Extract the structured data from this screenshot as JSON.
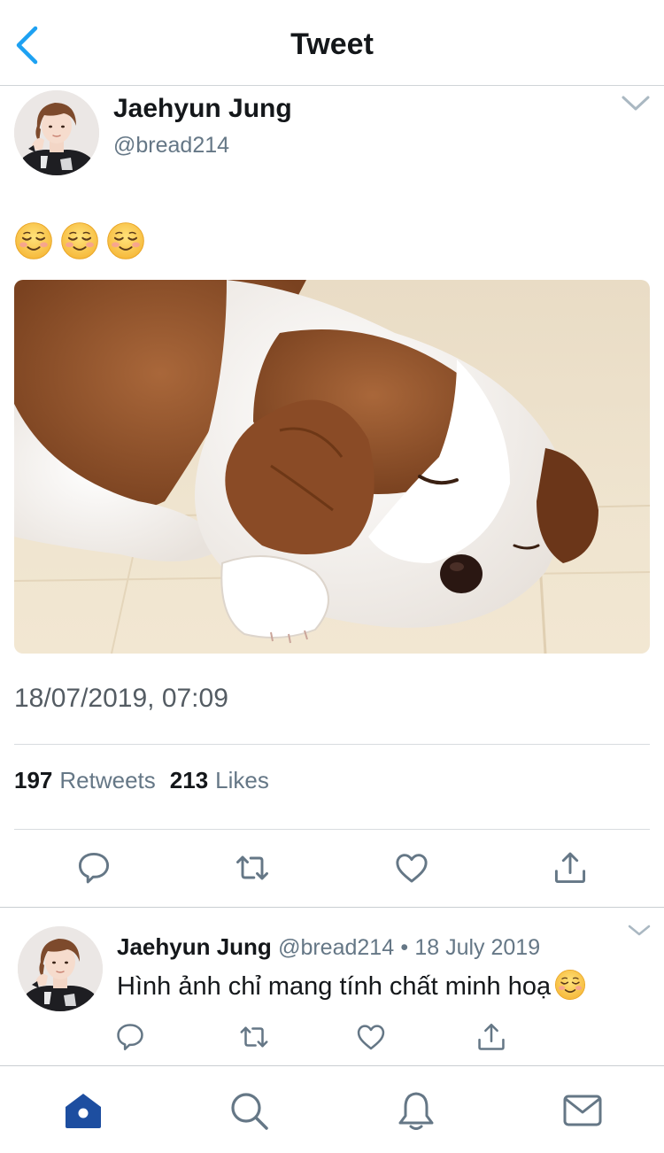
{
  "header": {
    "title": "Tweet",
    "back_icon": "chevron-left-icon"
  },
  "tweet": {
    "author": {
      "display_name": "Jaehyun Jung",
      "handle": "@bread214"
    },
    "text_emojis": [
      "smiling-face-emoji",
      "smiling-face-emoji",
      "smiling-face-emoji"
    ],
    "timestamp": "18/07/2019, 07:09",
    "stats": {
      "retweets_count": "197",
      "retweets_label": "Retweets",
      "likes_count": "213",
      "likes_label": "Likes"
    },
    "actions": [
      "reply-icon",
      "retweet-icon",
      "like-icon",
      "share-icon"
    ]
  },
  "reply": {
    "author": {
      "display_name": "Jaehyun Jung",
      "handle": "@bread214"
    },
    "separator": "•",
    "date": "18 July 2019",
    "text": "Hình ảnh chỉ mang tính chất minh hoạ",
    "actions": [
      "reply-icon",
      "retweet-icon",
      "like-icon",
      "share-icon"
    ]
  },
  "tabbar": {
    "items": [
      "home-icon",
      "search-icon",
      "notifications-icon",
      "messages-icon"
    ],
    "active": "home-icon"
  },
  "colors": {
    "accent_blue": "#1da1f2",
    "tab_active": "#1d4ea0",
    "icon_gray": "#657786",
    "text_dark": "#14171a"
  }
}
